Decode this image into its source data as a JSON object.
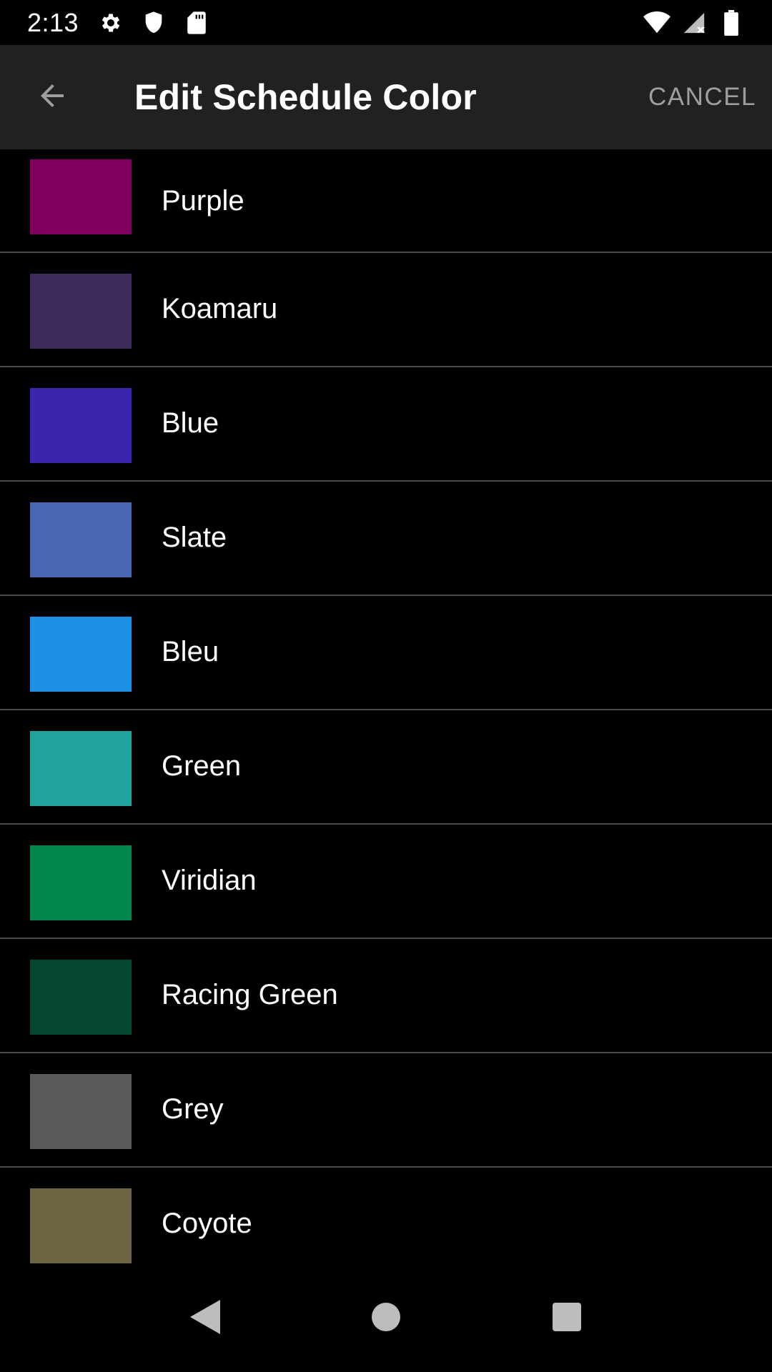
{
  "status_bar": {
    "time": "2:13",
    "icons_left": [
      "gear-icon",
      "shield-icon",
      "sd-card-icon"
    ],
    "icons_right": [
      "wifi-icon",
      "cell-signal-icon",
      "battery-icon"
    ]
  },
  "app_bar": {
    "title": "Edit Schedule Color",
    "cancel_label": "CANCEL",
    "back_icon": "arrow-back-icon"
  },
  "colors": [
    {
      "label": "Purple",
      "color": "#800060"
    },
    {
      "label": "Koamaru",
      "color": "#3d2b5c"
    },
    {
      "label": "Blue",
      "color": "#3a26ad"
    },
    {
      "label": "Slate",
      "color": "#4a67b2"
    },
    {
      "label": "Bleu",
      "color": "#1e90e6"
    },
    {
      "label": "Green",
      "color": "#22a29f"
    },
    {
      "label": "Viridian",
      "color": "#00864a"
    },
    {
      "label": "Racing Green",
      "color": "#05472f"
    },
    {
      "label": "Grey",
      "color": "#5a5a5a"
    },
    {
      "label": "Coyote",
      "color": "#6e6441"
    }
  ],
  "nav_bar": {
    "icons": [
      "nav-back-icon",
      "nav-home-icon",
      "nav-recents-icon"
    ]
  }
}
